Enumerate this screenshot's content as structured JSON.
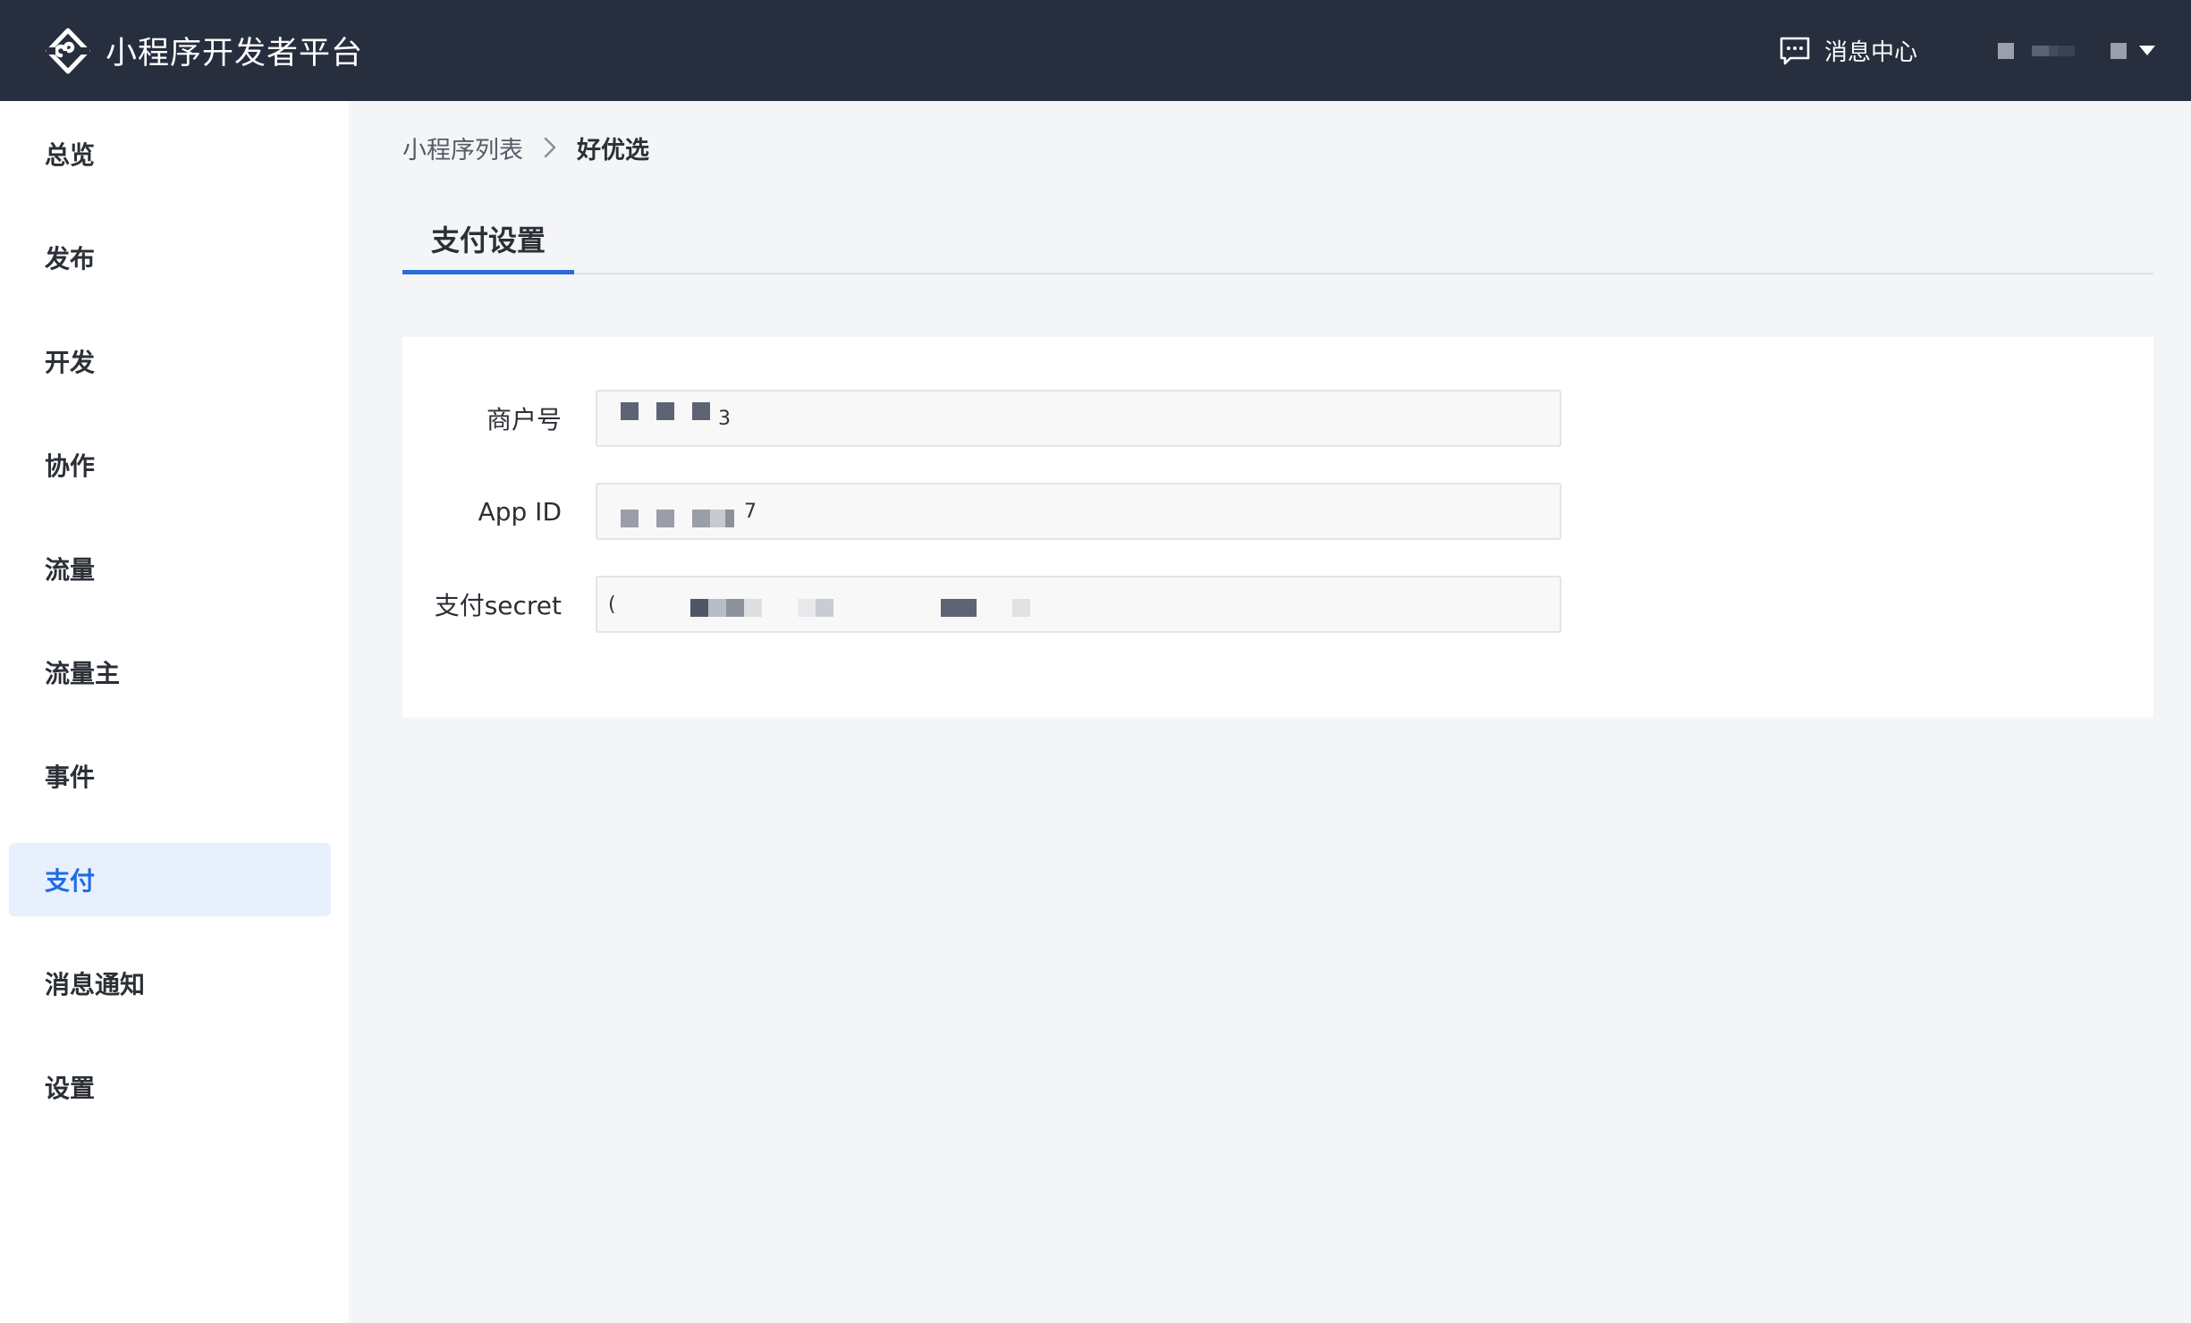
{
  "header": {
    "title": "小程序开发者平台",
    "logo_icon": "mini-program-logo-icon",
    "message_center_label": "消息中心",
    "message_icon": "chat-bubble-icon"
  },
  "sidebar": {
    "items": [
      {
        "label": "总览"
      },
      {
        "label": "发布"
      },
      {
        "label": "开发"
      },
      {
        "label": "协作"
      },
      {
        "label": "流量"
      },
      {
        "label": "流量主"
      },
      {
        "label": "事件"
      },
      {
        "label": "支付",
        "active": true
      },
      {
        "label": "消息通知"
      },
      {
        "label": "设置"
      }
    ]
  },
  "breadcrumb": {
    "parent": "小程序列表",
    "current": "好优选"
  },
  "tabs": [
    {
      "label": "支付设置",
      "active": true
    }
  ],
  "form": {
    "merchant_id": {
      "label": "商户号",
      "value": "3"
    },
    "app_id": {
      "label": "App ID",
      "value": "7"
    },
    "pay_secret": {
      "label": "支付secret",
      "value": "("
    }
  },
  "colors": {
    "topbar": "#272e3d",
    "accent": "#2a6cd8",
    "active_bg": "#e8f0fd",
    "page_bg": "#f4f5f7"
  }
}
